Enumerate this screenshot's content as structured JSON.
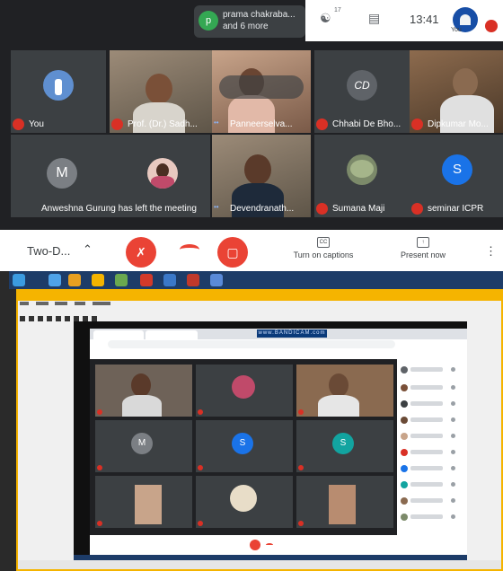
{
  "header": {
    "presenter_chip": {
      "avatar_letter": "p",
      "line1": "prama chakraba...",
      "line2": "and 6 more"
    },
    "participants_count": "17",
    "clock": "13:41",
    "self_label": "You"
  },
  "tiles": [
    {
      "name": "You"
    },
    {
      "name": "Prof. (Dr.) Sadh..."
    },
    {
      "name": "Panneerselva..."
    },
    {
      "name": "Chhabi De Bho..."
    },
    {
      "name": "Dipkumar Mo..."
    },
    {
      "name": "Anweshna Gurung has left the meeting",
      "avatar_letter": "M"
    },
    {
      "name": ""
    },
    {
      "name": "Devendranath..."
    },
    {
      "name": "Sumana Maji"
    },
    {
      "name": "seminar ICPR",
      "avatar_letter": "S"
    }
  ],
  "controls": {
    "meeting_title": "Two-D...",
    "captions_label": "Turn on captions",
    "present_label": "Present now"
  },
  "recording": {
    "bandicam": "www.BANDICAM.com",
    "inner_avatar_letters": [
      "M",
      "S",
      "S"
    ]
  },
  "colors": {
    "meet_bg": "#202124",
    "tile_bg": "#3c4043",
    "danger": "#ea4335",
    "vlc_accent": "#f5b400"
  }
}
